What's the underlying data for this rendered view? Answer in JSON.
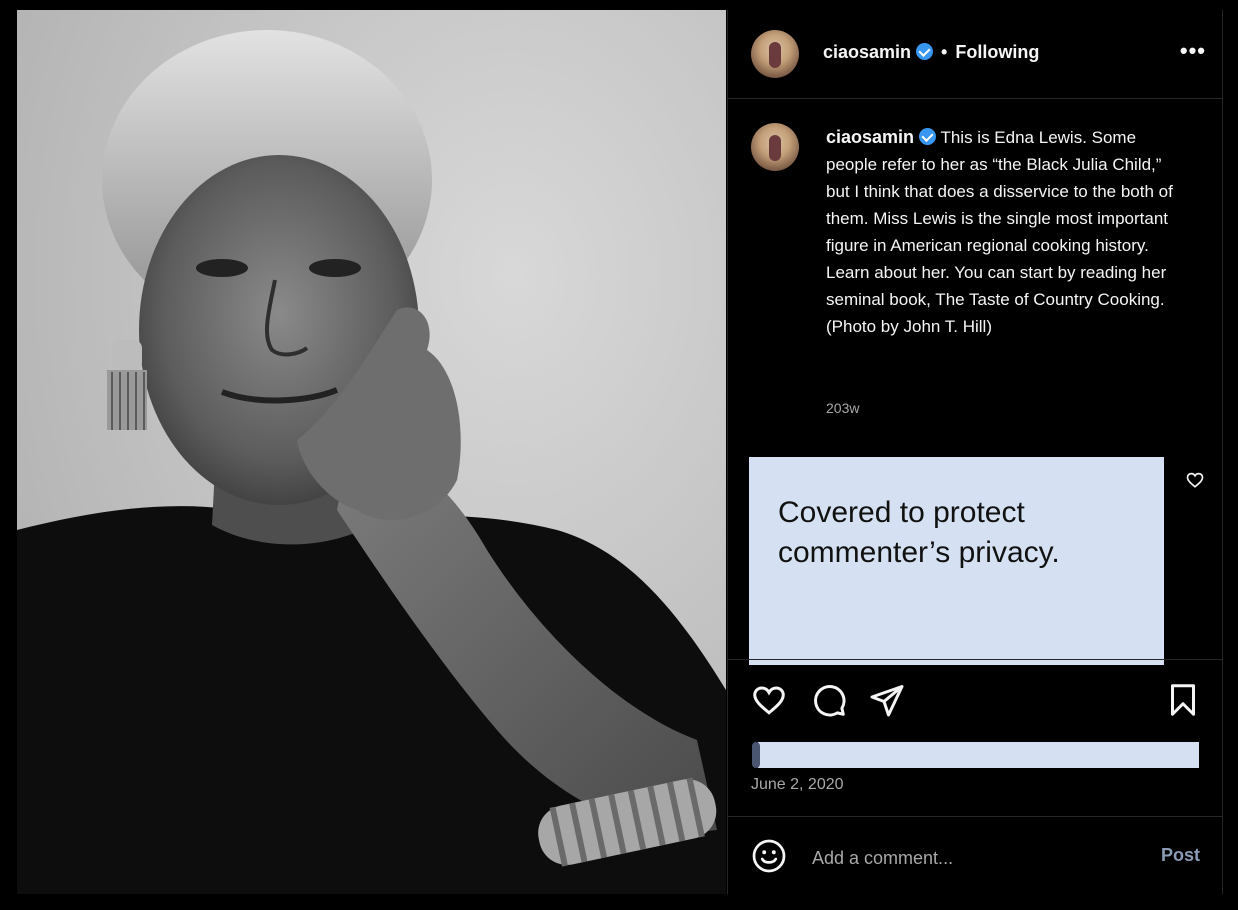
{
  "post": {
    "username": "ciaosamin",
    "separator": "•",
    "follow_status": "Following",
    "more_label": "•••",
    "caption_text": "This is Edna Lewis. Some people refer to her as “the Black Julia Child,” but I think that does a disservice to the both of them. Miss Lewis is the single most important figure in American regional cooking history. Learn about her. You can start by reading her seminal book, The Taste of Country Cooking. (Photo by John T. Hill)",
    "time_ago": "203w",
    "date": "June 2, 2020"
  },
  "comments": {
    "privacy_note": "Covered to protect commenter’s privacy."
  },
  "composer": {
    "placeholder": "Add a comment...",
    "post_label": "Post"
  },
  "icons": {
    "verified": "verified-badge-icon",
    "more": "more-options-icon",
    "like": "heart-icon",
    "comment": "comment-bubble-icon",
    "share": "paper-plane-icon",
    "save": "bookmark-icon",
    "emoji": "smiley-icon"
  },
  "colors": {
    "background": "#000000",
    "verified_blue": "#3897f0",
    "privacy_cover": "#d5e1f2",
    "muted_text": "#a8a8a8",
    "post_button": "#8a9bb4"
  }
}
